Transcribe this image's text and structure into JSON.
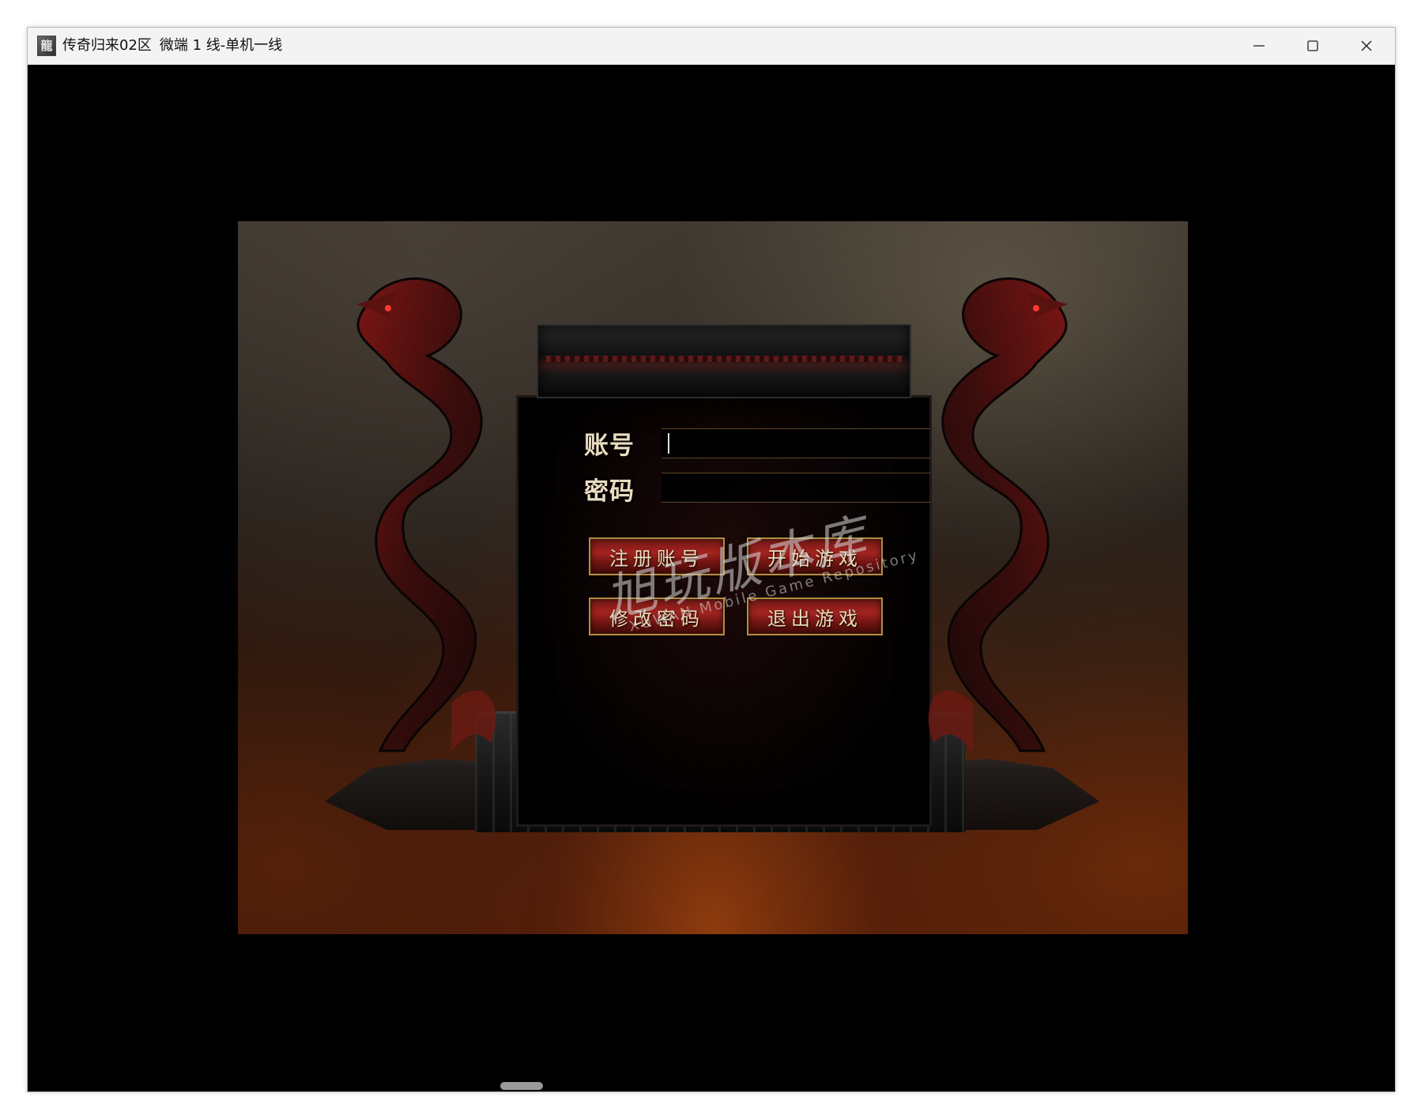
{
  "window": {
    "title_game": "传奇归来02区",
    "title_line": "微端 1 线-单机一线",
    "app_icon_char": "龍",
    "buttons": {
      "minimize_icon": "minimize-icon",
      "maximize_icon": "maximize-icon",
      "close_icon": "close-icon"
    }
  },
  "login": {
    "account_label": "账号",
    "password_label": "密码",
    "account_value": "",
    "password_value": "",
    "buttons": {
      "register": "注册账号",
      "start": "开始游戏",
      "change_password": "修改密码",
      "exit": "退出游戏"
    }
  },
  "watermark": {
    "main": "旭玩版本库",
    "sub": "XUWAN Mobile Game Repository"
  },
  "colors": {
    "button_red": "#a3231f",
    "button_border_gold": "#b58a43",
    "label_text": "#e9dcc0"
  }
}
